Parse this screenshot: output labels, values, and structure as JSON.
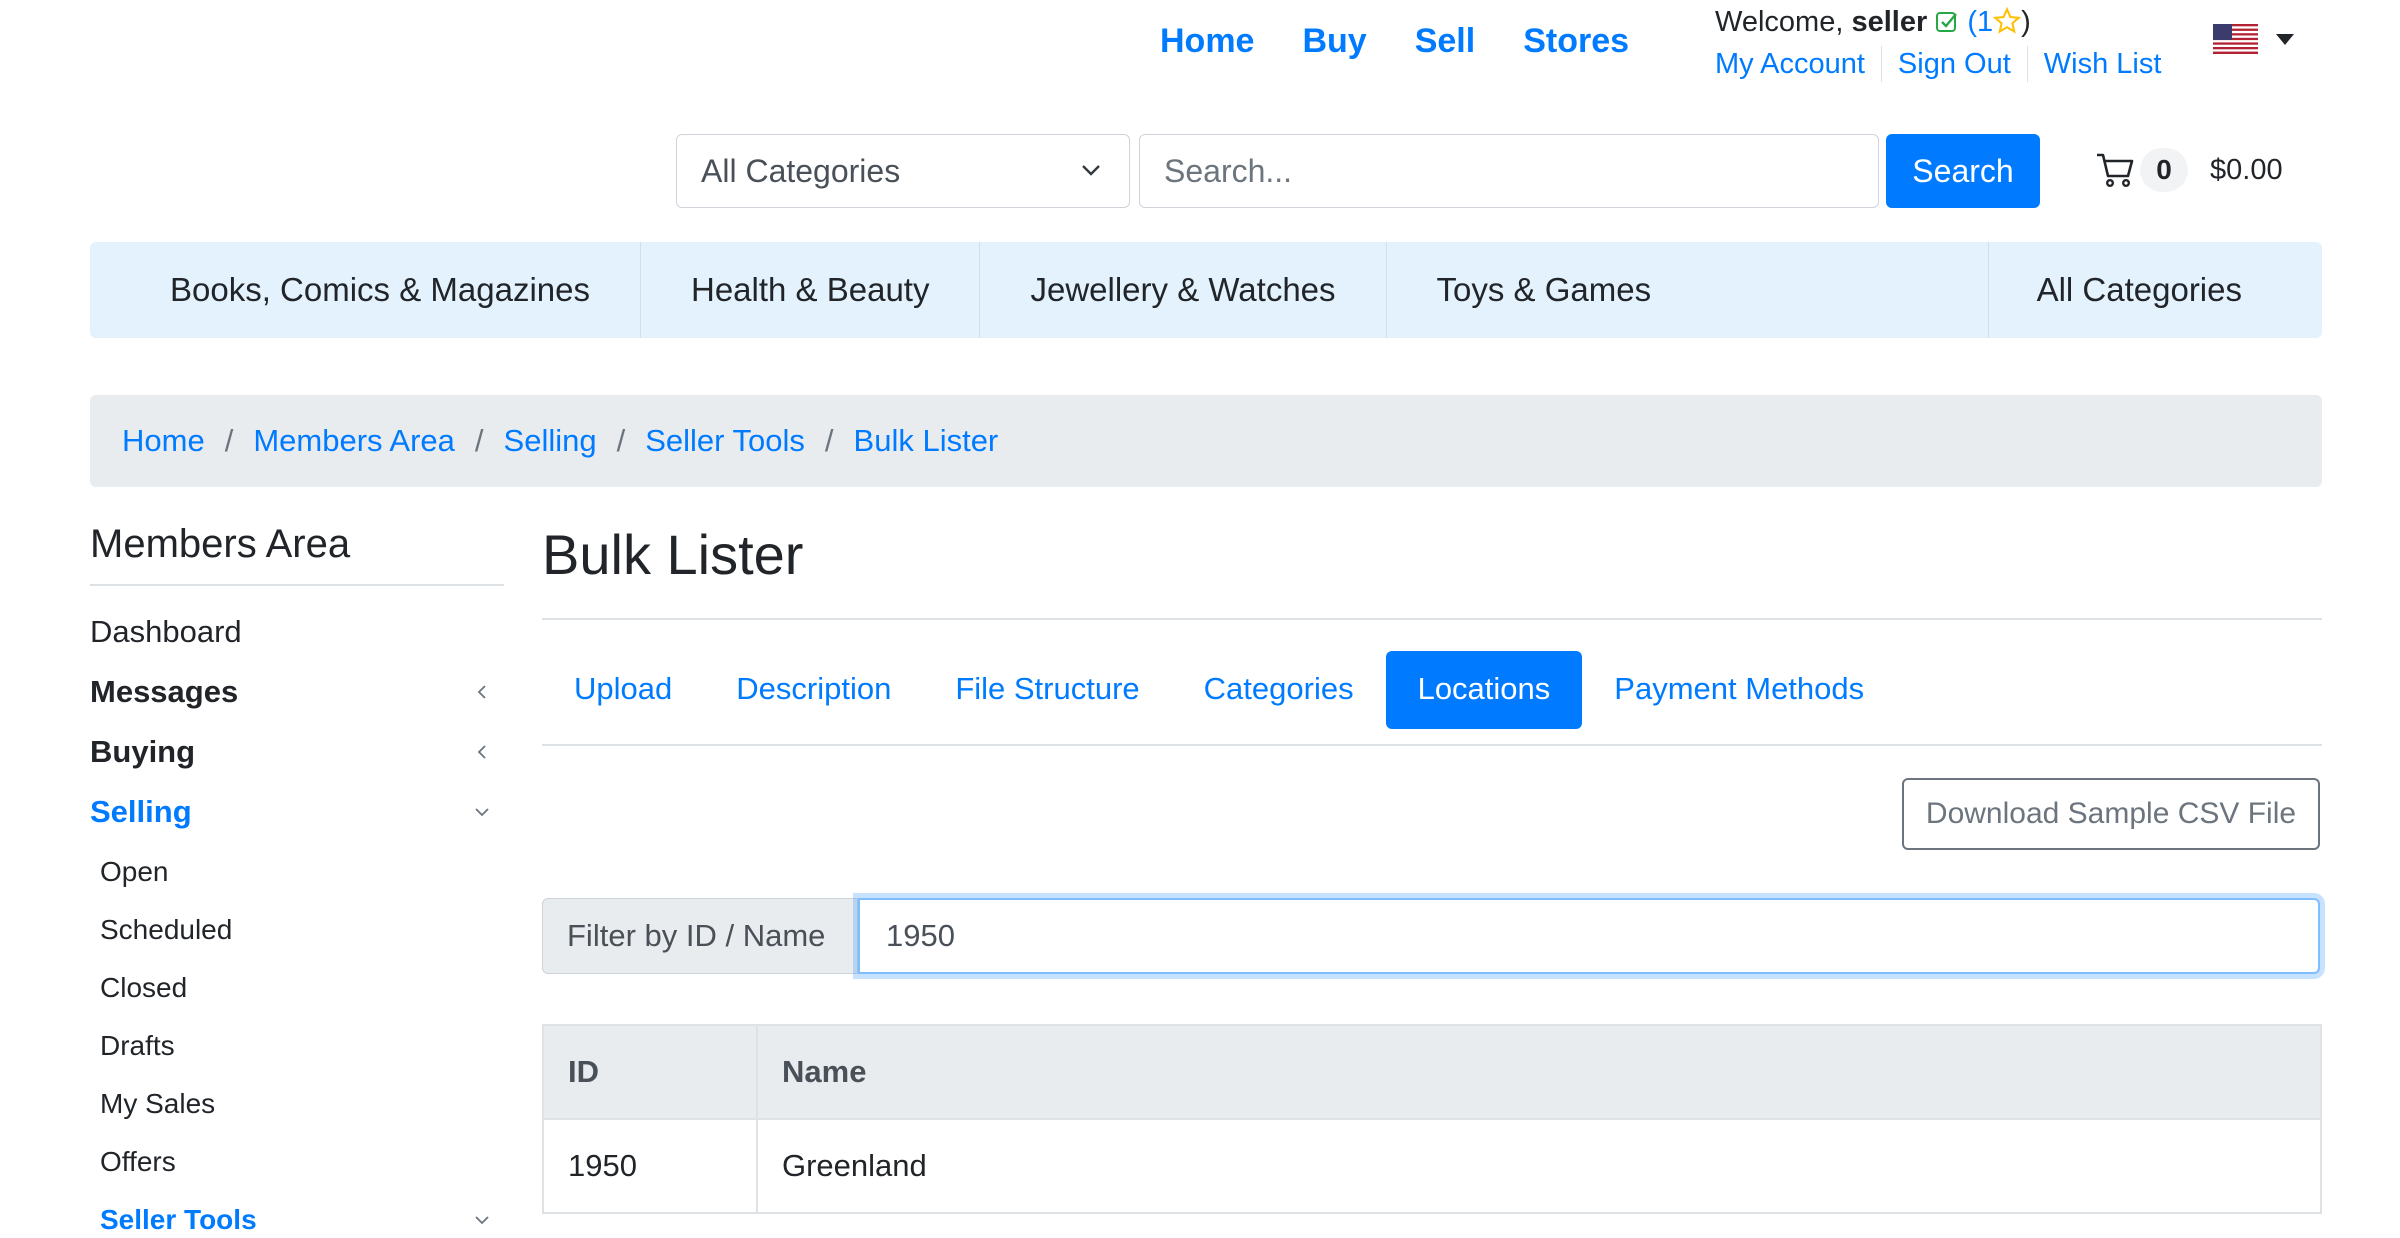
{
  "top_nav": [
    "Home",
    "Buy",
    "Sell",
    "Stores"
  ],
  "user": {
    "welcome_prefix": "Welcome,",
    "username": "seller",
    "rating_open": "(1",
    "rating_close": ")"
  },
  "account_links": [
    "My Account",
    "Sign Out",
    "Wish List"
  ],
  "search": {
    "category_selected": "All Categories",
    "placeholder": "Search...",
    "button_label": "Search"
  },
  "cart": {
    "count": "0",
    "total": "$0.00"
  },
  "category_bar": [
    "Books, Comics & Magazines",
    "Health & Beauty",
    "Jewellery & Watches",
    "Toys & Games"
  ],
  "category_bar_all": "All Categories",
  "breadcrumb": [
    "Home",
    "Members Area",
    "Selling",
    "Seller Tools",
    "Bulk Lister"
  ],
  "breadcrumb_separator": "/",
  "sidebar": {
    "title": "Members Area",
    "items": [
      {
        "label": "Dashboard"
      },
      {
        "label": "Messages"
      },
      {
        "label": "Buying"
      },
      {
        "label": "Selling"
      }
    ],
    "selling_sub": [
      "Open",
      "Scheduled",
      "Closed",
      "Drafts",
      "My Sales",
      "Offers",
      "Seller Tools"
    ]
  },
  "main": {
    "title": "Bulk Lister",
    "tabs": [
      "Upload",
      "Description",
      "File Structure",
      "Categories",
      "Locations",
      "Payment Methods"
    ],
    "active_tab": "Locations",
    "download_button": "Download Sample CSV File",
    "filter_label": "Filter by ID / Name",
    "filter_value": "1950",
    "table": {
      "headers": [
        "ID",
        "Name"
      ],
      "rows": [
        [
          "1950",
          "Greenland"
        ]
      ]
    }
  },
  "colors": {
    "primary": "#007bff",
    "category_bar_bg": "#e3f2fd",
    "breadcrumb_bg": "#e9ecef",
    "check_green": "#28a745",
    "star_yellow": "#ffc107"
  }
}
